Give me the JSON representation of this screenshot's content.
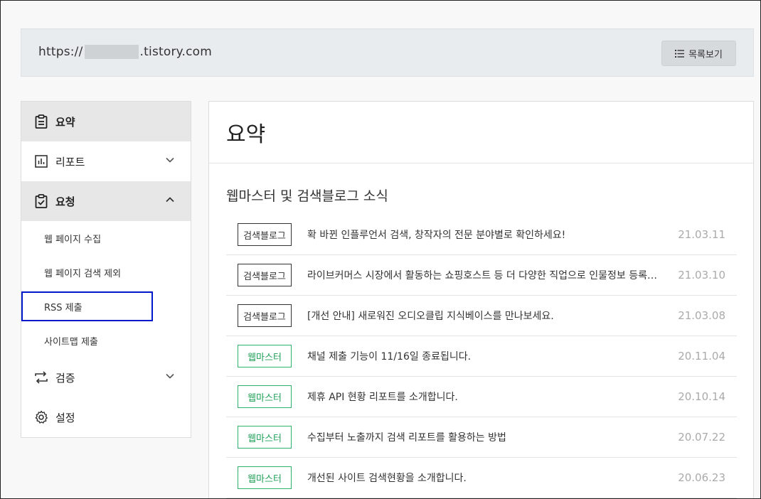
{
  "url": {
    "prefix": "https://",
    "suffix": ".tistory.com"
  },
  "list_button": {
    "label": "목록보기",
    "icon": "list-icon"
  },
  "sidebar": {
    "items": [
      {
        "label": "요약",
        "icon": "clipboard-icon"
      },
      {
        "label": "리포트",
        "icon": "bar-chart-icon"
      },
      {
        "label": "요청",
        "icon": "checklist-icon"
      },
      {
        "label": "검증",
        "icon": "repeat-icon"
      },
      {
        "label": "설정",
        "icon": "gear-icon"
      }
    ],
    "sub_items": [
      {
        "label": "웹 페이지 수집"
      },
      {
        "label": "웹 페이지 검색 제외"
      },
      {
        "label": "RSS 제출"
      },
      {
        "label": "사이트맵 제출"
      }
    ]
  },
  "main": {
    "title": "요약",
    "news_title": "웹마스터 및 검색블로그 소식",
    "news": [
      {
        "category": "검색블로그",
        "text": "확 바뀐 인플루언서 검색, 창작자의 전문 분야별로 확인하세요!",
        "date": "21.03.11"
      },
      {
        "category": "검색블로그",
        "text": "라이브커머스 시장에서 활동하는 쇼핑호스트 등 더 다양한 직업으로 인물정보 등록…",
        "date": "21.03.10"
      },
      {
        "category": "검색블로그",
        "text": "[개선 안내] 새로워진 오디오클립 지식베이스를 만나보세요.",
        "date": "21.03.08"
      },
      {
        "category": "웹마스터",
        "text": "채널 제출 기능이 11/16일 종료됩니다.",
        "date": "20.11.04"
      },
      {
        "category": "웹마스터",
        "text": "제휴 API 현황 리포트를 소개합니다.",
        "date": "20.10.14"
      },
      {
        "category": "웹마스터",
        "text": "수집부터 노출까지 검색 리포트를 활용하는 방법",
        "date": "20.07.22"
      },
      {
        "category": "웹마스터",
        "text": "개선된 사이트 검색현황을 소개합니다.",
        "date": "20.06.23"
      }
    ]
  },
  "colors": {
    "green_badge": "#1e9f57",
    "highlight_box": "#0019c8"
  }
}
